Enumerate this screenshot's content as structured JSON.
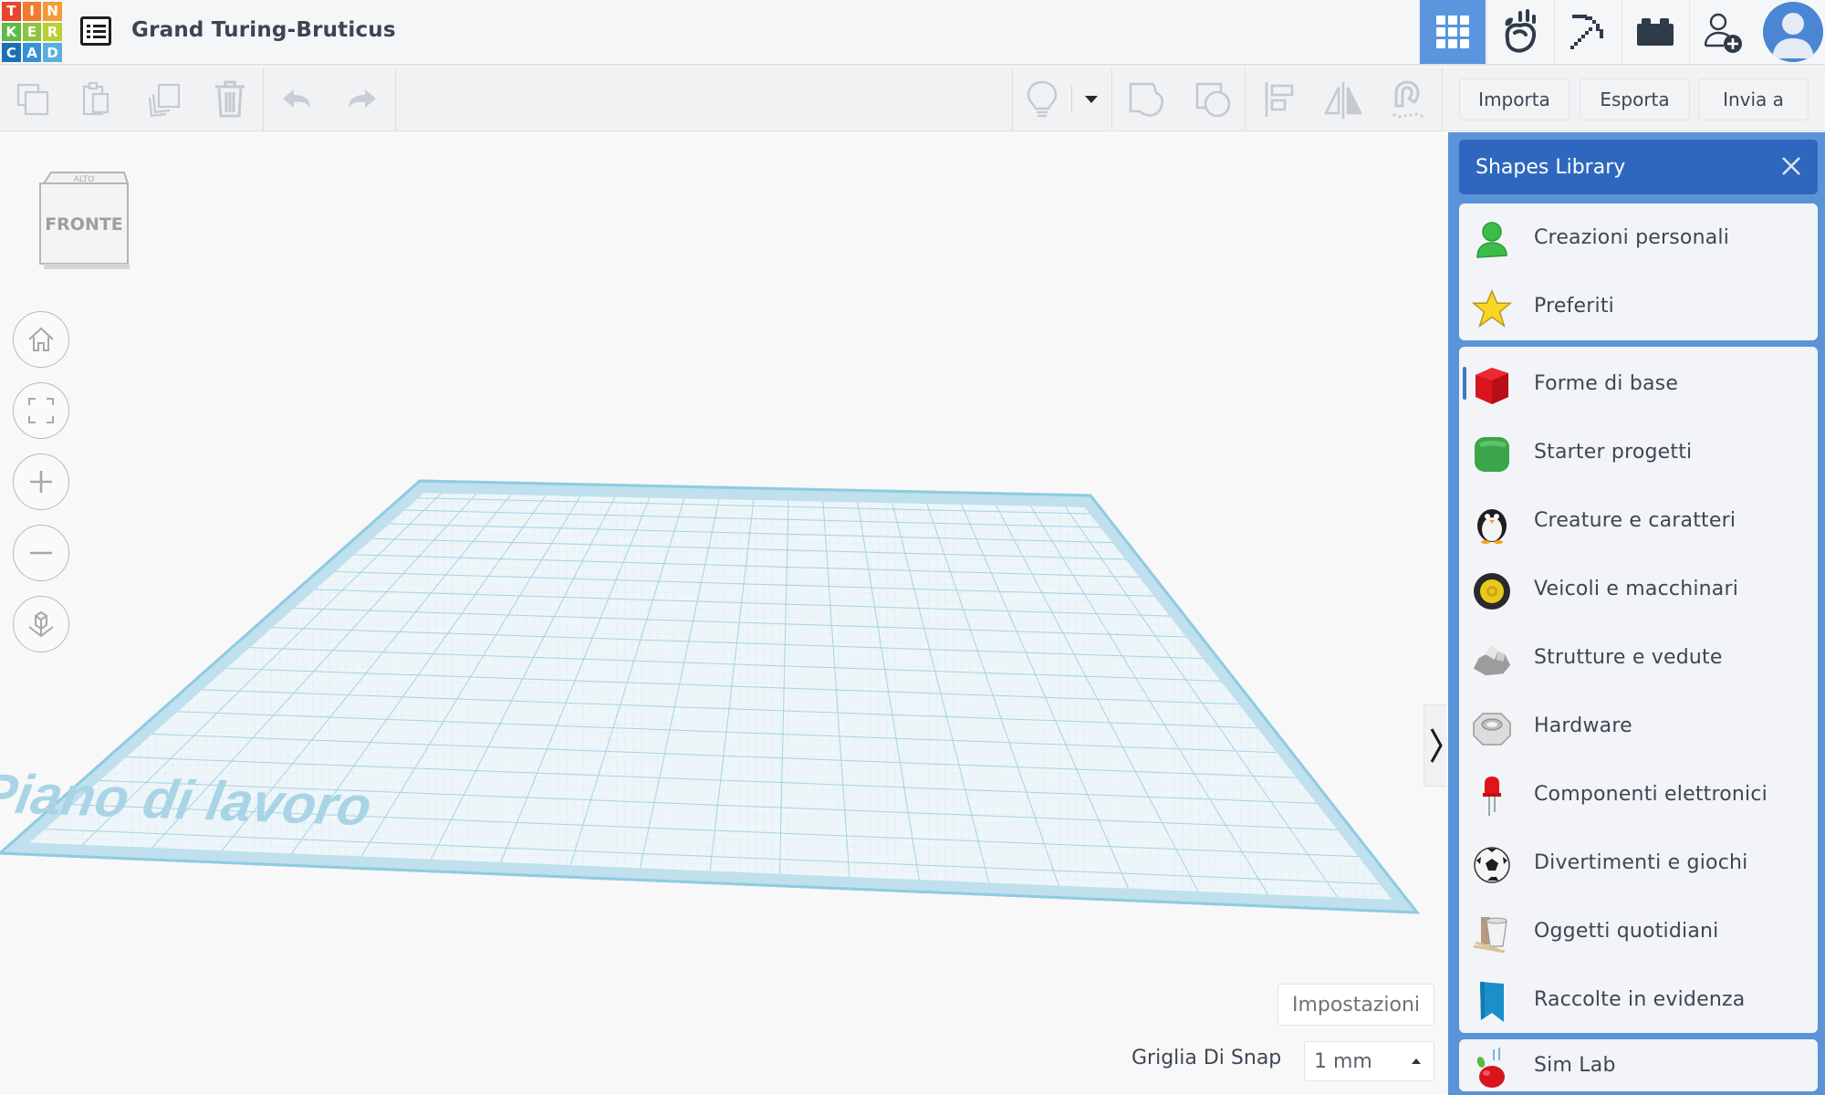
{
  "app": {
    "logo_letters": [
      "T",
      "I",
      "N",
      "K",
      "E",
      "R",
      "C",
      "A",
      "D"
    ],
    "logo_colors": [
      "#e8452c",
      "#f58d2a",
      "#f58d2a",
      "#6cc24a",
      "#9bcb3c",
      "#c3d32f",
      "#1d74b9",
      "#3a99d8",
      "#5bb3e0"
    ],
    "design_title": "Grand Turing-Bruticus"
  },
  "topnav": {
    "items": [
      {
        "name": "3d-design",
        "icon": "grid-icon",
        "active": true
      },
      {
        "name": "sim-lab",
        "icon": "falling-apple-icon",
        "active": false
      },
      {
        "name": "minecraft",
        "icon": "pickaxe-icon",
        "active": false
      },
      {
        "name": "bricks",
        "icon": "brick-icon",
        "active": false
      },
      {
        "name": "add-user",
        "icon": "user-add-icon",
        "active": false
      }
    ],
    "accent_color": "#5b95dd"
  },
  "toolbar": {
    "edit_tools": [
      {
        "name": "copy",
        "icon": "copy-icon"
      },
      {
        "name": "paste",
        "icon": "paste-icon"
      },
      {
        "name": "duplicate",
        "icon": "duplicate-icon"
      },
      {
        "name": "delete",
        "icon": "trash-icon"
      }
    ],
    "history_tools": [
      {
        "name": "undo",
        "icon": "undo-icon"
      },
      {
        "name": "redo",
        "icon": "redo-icon"
      }
    ],
    "view_tools": [
      {
        "name": "notes",
        "icon": "lightbulb-icon"
      },
      {
        "name": "notes-dropdown",
        "icon": "caret-down-icon"
      },
      {
        "name": "group",
        "icon": "group-icon"
      },
      {
        "name": "ungroup",
        "icon": "ungroup-icon"
      },
      {
        "name": "align",
        "icon": "align-icon"
      },
      {
        "name": "mirror",
        "icon": "mirror-icon"
      },
      {
        "name": "cruise",
        "icon": "magnet-icon"
      }
    ],
    "import_label": "Importa",
    "export_label": "Esporta",
    "send_label": "Invia a"
  },
  "viewport": {
    "viewcube_label": "FRONTE",
    "viewcube_top_label": "ALTO",
    "controls": [
      {
        "name": "home-view",
        "icon": "home-icon"
      },
      {
        "name": "fit-view",
        "icon": "fit-icon"
      },
      {
        "name": "zoom-in",
        "icon": "plus-icon"
      },
      {
        "name": "zoom-out",
        "icon": "minus-icon"
      },
      {
        "name": "ortho-view",
        "icon": "perspective-cube-icon"
      }
    ],
    "workplane_label": "Piano di lavoro",
    "settings_label": "Impostazioni",
    "snap_label": "Griglia Di Snap",
    "snap_value": "1 mm"
  },
  "shapes_panel": {
    "title": "Shapes Library",
    "header_color": "#2f67be",
    "panel_color": "#5b93d8",
    "group1": [
      {
        "label": "Creazioni personali",
        "icon": "person-icon"
      },
      {
        "label": "Preferiti",
        "icon": "star-icon"
      }
    ],
    "group2": [
      {
        "label": "Forme di base",
        "icon": "red-cube-icon",
        "active": true
      },
      {
        "label": "Starter progetti",
        "icon": "green-cube-icon"
      },
      {
        "label": "Creature e caratteri",
        "icon": "penguin-icon"
      },
      {
        "label": "Veicoli e macchinari",
        "icon": "wheel-icon"
      },
      {
        "label": "Strutture e vedute",
        "icon": "rock-icon"
      },
      {
        "label": "Hardware",
        "icon": "nut-icon"
      },
      {
        "label": "Componenti elettronici",
        "icon": "led-icon"
      },
      {
        "label": "Divertimenti e giochi",
        "icon": "soccer-ball-icon"
      },
      {
        "label": "Oggetti quotidiani",
        "icon": "cup-icon"
      },
      {
        "label": "Raccolte in evidenza",
        "icon": "bookmark-icon"
      }
    ],
    "group3": [
      {
        "label": "Sim Lab",
        "icon": "apple-icon"
      }
    ]
  }
}
